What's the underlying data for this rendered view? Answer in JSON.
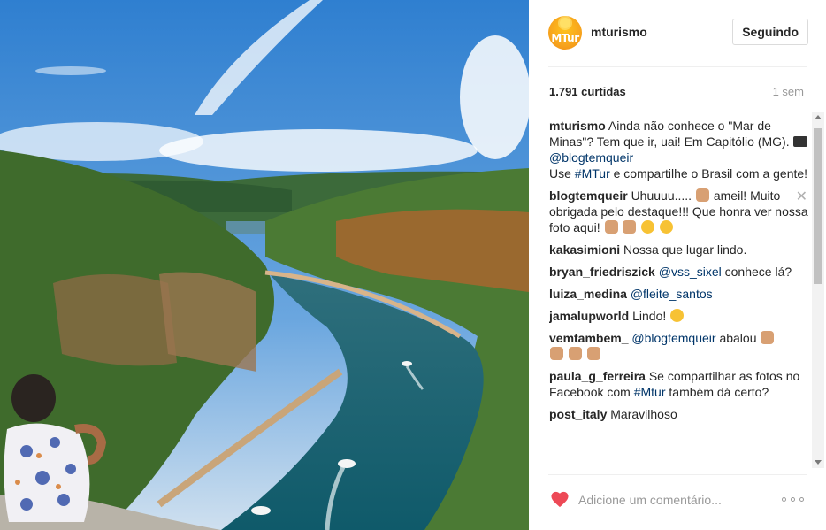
{
  "post": {
    "account": "mturismo",
    "avatar_text": "MTur",
    "follow_label": "Seguindo",
    "likes": "1.791 curtidas",
    "time": "1 sem"
  },
  "caption": {
    "user": "mturismo",
    "text_1": "Ainda não conhece o \"Mar de Minas\"? Tem que ir, uai! Em Capitólio (MG).",
    "mention": "@blogtemqueir",
    "text_2": "Use",
    "hashtag": "#MTur",
    "text_3": "e compartilhe o Brasil com a gente!"
  },
  "comments": [
    {
      "user": "blogtemqueir",
      "text": "Uhuuuu.....",
      "text_b": "ameil! Muito obrigada pelo destaque!!! Que honra ver nossa foto aqui!"
    },
    {
      "user": "kakasimioni",
      "text": "Nossa que lugar lindo."
    },
    {
      "user": "bryan_friedriszick",
      "mention": "@vss_sixel",
      "text": "conhece lá?"
    },
    {
      "user": "luiza_medina",
      "mention": "@fleite_santos"
    },
    {
      "user": "jamalupworld",
      "text": "Lindo!"
    },
    {
      "user": "vemtambem_",
      "mention": "@blogtemqueir",
      "text": "abalou"
    },
    {
      "user": "paula_g_ferreira",
      "text": "Se compartilhar as fotos no Facebook com",
      "hashtag": "#Mtur",
      "text_b": "também dá certo?"
    },
    {
      "user": "post_italy",
      "text": "Maravilhoso"
    }
  ],
  "composer": {
    "placeholder": "Adicione um comentário..."
  },
  "icons": {
    "like": "heart-icon",
    "more": "more-options-icon",
    "close": "close-icon",
    "camera": "camera-emoji-icon"
  },
  "colors": {
    "heart": "#ed4956",
    "link": "#003569",
    "muted": "#999999"
  }
}
